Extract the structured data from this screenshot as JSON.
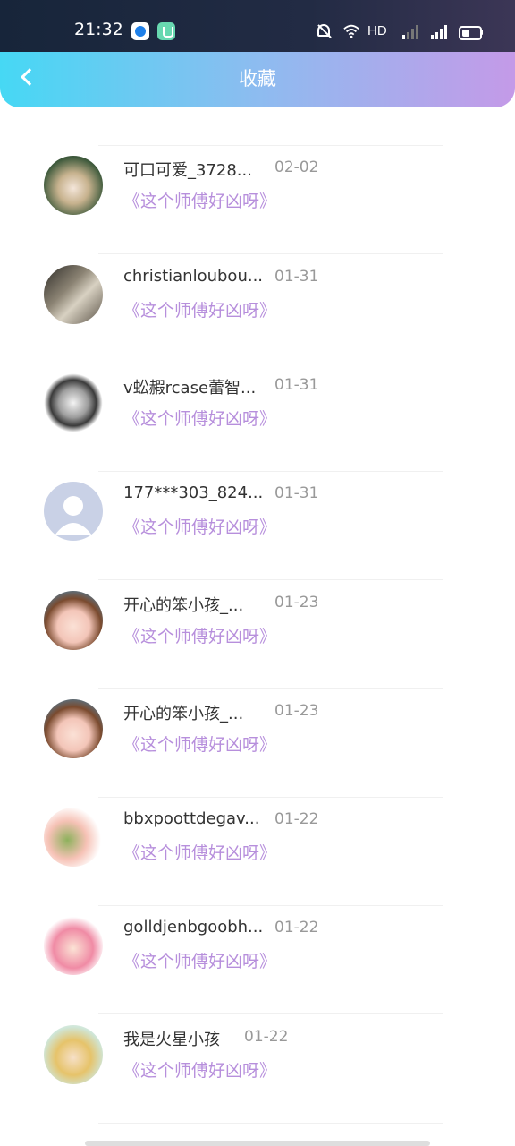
{
  "status_bar": {
    "time": "21:32",
    "network_label": "HD",
    "icons": [
      "app-icon-1",
      "app-icon-2",
      "app-icon-3",
      "bell-muted-icon",
      "wifi-icon",
      "signal-icon",
      "signal-4g-icon",
      "battery-icon"
    ]
  },
  "nav": {
    "back_icon": "chevron-left-icon",
    "title": "收藏"
  },
  "items": [
    {
      "name": "",
      "date": "",
      "title": "《这个师傅好凶呀》",
      "avatar": "avatar-partial"
    },
    {
      "name": "可口可爱_3728...",
      "date": "02-02",
      "title": "《这个师傅好凶呀》",
      "avatar": "avatar-anime-girl"
    },
    {
      "name": "christianloubou...",
      "date": "01-31",
      "title": "《这个师傅好凶呀》",
      "avatar": "avatar-book"
    },
    {
      "name": "v蚣赮rcase蕾智...",
      "date": "01-31",
      "title": "《这个师傅好凶呀》",
      "avatar": "avatar-skull-ring"
    },
    {
      "name": "177***303_824...",
      "date": "01-31",
      "title": "《这个师傅好凶呀》",
      "avatar": "avatar-default"
    },
    {
      "name": "开心的笨小孩_...",
      "date": "01-23",
      "title": "《这个师傅好凶呀》",
      "avatar": "avatar-anime-girl-2"
    },
    {
      "name": "开心的笨小孩_...",
      "date": "01-23",
      "title": "《这个师傅好凶呀》",
      "avatar": "avatar-anime-girl-2"
    },
    {
      "name": "bbxpoottdegav...",
      "date": "01-22",
      "title": "《这个师傅好凶呀》",
      "avatar": "avatar-cartoon-pair"
    },
    {
      "name": "golldjenbgoobh...",
      "date": "01-22",
      "title": "《这个师傅好凶呀》",
      "avatar": "avatar-pink-hair"
    },
    {
      "name": "我是火星小孩",
      "date": "01-22",
      "title": "《这个师傅好凶呀》",
      "avatar": "avatar-kids"
    }
  ],
  "colors": {
    "header_gradient": [
      "#46d8f4",
      "#c49ae8"
    ],
    "title_accent": "#b78fdc",
    "date_gray": "#999999"
  }
}
